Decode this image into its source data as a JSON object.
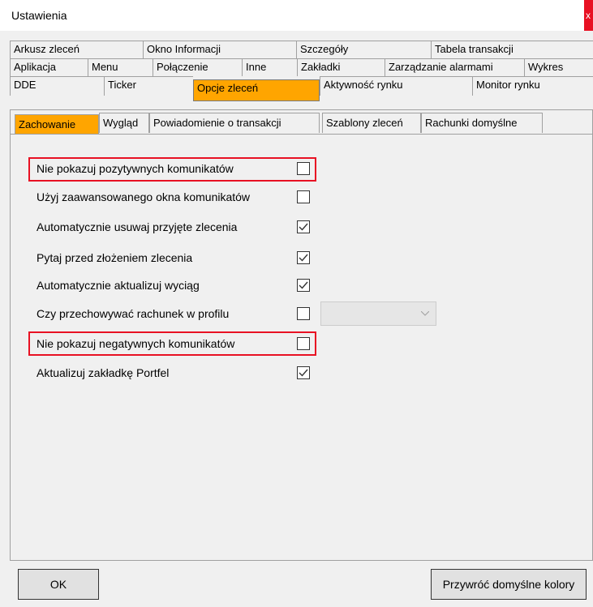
{
  "window": {
    "title": "Ustawienia",
    "close": "x"
  },
  "tabs": {
    "row1": [
      "Arkusz zleceń",
      "Okno Informacji",
      "Szczegóły",
      "Tabela transakcji"
    ],
    "row2": [
      "Aplikacja",
      "Menu",
      "Połączenie",
      "Inne",
      "Zakładki",
      "Zarządzanie alarmami",
      "Wykres"
    ],
    "row3": [
      "DDE",
      "Ticker",
      "Opcje zleceń",
      "Aktywność rynku",
      "Monitor rynku"
    ]
  },
  "subtabs": [
    "Zachowanie",
    "Wygląd",
    "Powiadomienie o transakcji",
    "Szablony zleceń",
    "Rachunki domyślne"
  ],
  "options": [
    {
      "label": "Nie pokazuj pozytywnych komunikatów",
      "checked": false
    },
    {
      "label": "Użyj zaawansowanego okna komunikatów",
      "checked": false
    },
    {
      "label": "Automatycznie usuwaj przyjęte zlecenia",
      "checked": true
    },
    {
      "label": "Pytaj przed złożeniem zlecenia",
      "checked": true
    },
    {
      "label": "Automatycznie aktualizuj wyciąg",
      "checked": true
    },
    {
      "label": "Czy przechowywać rachunek w profilu",
      "checked": false
    },
    {
      "label": "Nie pokazuj negatywnych komunikatów",
      "checked": false
    },
    {
      "label": "Aktualizuj zakładkę Portfel",
      "checked": true
    }
  ],
  "buttons": {
    "ok": "OK",
    "reset_colors": "Przywróć domyślne kolory"
  },
  "colors": {
    "active_tab": "#ffa500",
    "highlight": "#e81123"
  }
}
